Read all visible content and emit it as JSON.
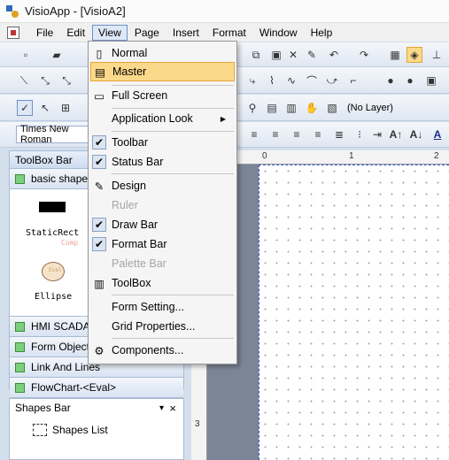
{
  "window": {
    "title": "VisioApp - [VisioA2]"
  },
  "menubar": {
    "items": [
      "File",
      "Edit",
      "View",
      "Page",
      "Insert",
      "Format",
      "Window",
      "Help"
    ],
    "open_item": "View"
  },
  "view_menu": {
    "items": [
      {
        "label": "Normal",
        "icon": "page-icon"
      },
      {
        "label": "Master",
        "icon": "master-icon",
        "highlighted": true
      },
      {
        "label": "Full Screen",
        "icon": "fullscreen-icon"
      },
      {
        "label": "Application Look",
        "icon": "",
        "submenu": true
      },
      {
        "label": "Toolbar",
        "checked": true
      },
      {
        "label": "Status Bar",
        "checked": true
      },
      {
        "label": "Design",
        "icon": "design-icon"
      },
      {
        "label": "Ruler",
        "disabled": true
      },
      {
        "label": "Draw Bar",
        "checked": true
      },
      {
        "label": "Format Bar",
        "checked": true
      },
      {
        "label": "Palette Bar",
        "disabled": true
      },
      {
        "label": "ToolBox",
        "icon": "toolbox-icon"
      },
      {
        "label": "Form Setting...",
        "icon": ""
      },
      {
        "label": "Grid Properties...",
        "icon": ""
      },
      {
        "label": "Components...",
        "icon": "components-icon"
      }
    ]
  },
  "toolbar": {
    "font_name": "Times New Roman",
    "layer": "(No Layer)"
  },
  "toolbox": {
    "title": "ToolBox Bar",
    "categories": [
      "basic shapes",
      "HMI SCADA",
      "Form Objects",
      "Link And Lines",
      "FlowChart-<Eval>"
    ],
    "shapes": [
      {
        "label": "StaticRect",
        "watermark": "Comp"
      },
      {
        "label": "Ellipse",
        "watermark": "Eval"
      }
    ]
  },
  "shapes_bar": {
    "title": "Shapes Bar",
    "pin": "▾",
    "close": "×",
    "list_label": "Shapes List"
  },
  "rulers": {
    "top_marks": [
      "0",
      "1",
      "2"
    ],
    "left_marks": [
      "3"
    ]
  },
  "colors": {
    "menu_highlight": "#fbd98a",
    "page_border": "#3355cc"
  }
}
